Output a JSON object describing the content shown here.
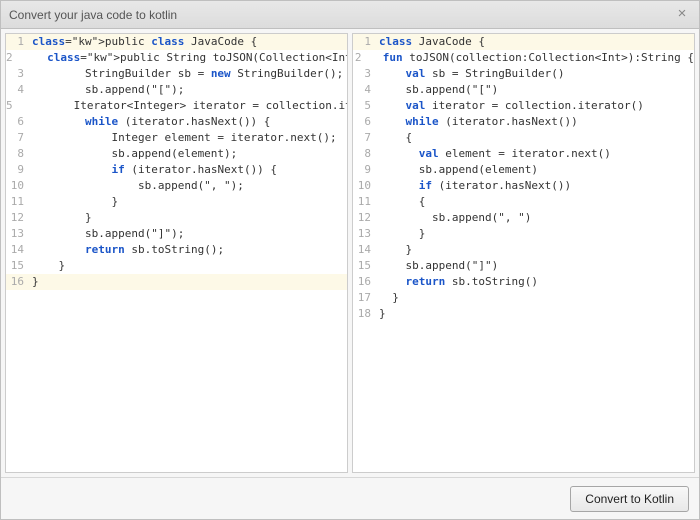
{
  "dialog": {
    "title": "Convert your java code to kotlin",
    "close_label": "×",
    "button_label": "Convert to Kotlin"
  },
  "syntax": {
    "keywords": [
      "public",
      "class",
      "new",
      "while",
      "if",
      "return",
      "fun",
      "val"
    ]
  },
  "java": {
    "highlighted_lines": [
      1,
      16
    ],
    "lines": [
      "public class JavaCode {",
      "    public String toJSON(Collection<Integer> collection) {",
      "        StringBuilder sb = new StringBuilder();",
      "        sb.append(\"[\");",
      "        Iterator<Integer> iterator = collection.iterator();",
      "        while (iterator.hasNext()) {",
      "            Integer element = iterator.next();",
      "            sb.append(element);",
      "            if (iterator.hasNext()) {",
      "                sb.append(\", \");",
      "            }",
      "        }",
      "        sb.append(\"]\");",
      "        return sb.toString();",
      "    }",
      "}"
    ]
  },
  "kotlin": {
    "highlighted_lines": [
      1
    ],
    "lines": [
      "class JavaCode {",
      "  fun toJSON(collection:Collection<Int>):String {",
      "    val sb = StringBuilder()",
      "    sb.append(\"[\")",
      "    val iterator = collection.iterator()",
      "    while (iterator.hasNext())",
      "    {",
      "      val element = iterator.next()",
      "      sb.append(element)",
      "      if (iterator.hasNext())",
      "      {",
      "        sb.append(\", \")",
      "      }",
      "    }",
      "    sb.append(\"]\")",
      "    return sb.toString()",
      "  }",
      "}"
    ]
  }
}
